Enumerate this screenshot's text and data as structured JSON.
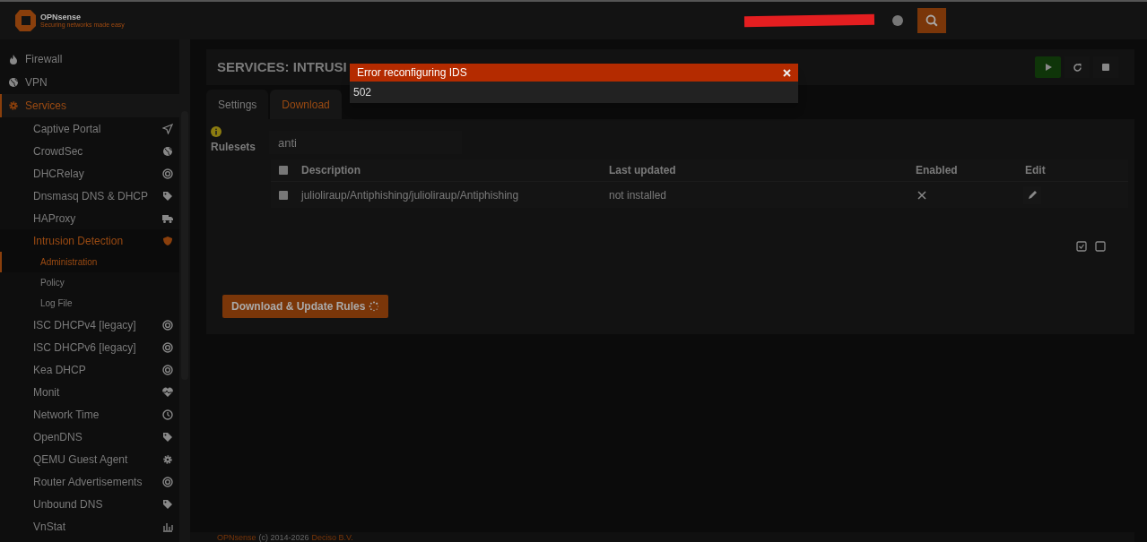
{
  "header": {
    "logo_text": "OPNsense",
    "logo_tagline": "Securing networks made easy"
  },
  "sidebar": {
    "items": [
      {
        "label": "Firewall",
        "selected": false
      },
      {
        "label": "VPN",
        "selected": false
      },
      {
        "label": "Services",
        "selected": true,
        "children": [
          {
            "label": "Captive Portal",
            "selected": false
          },
          {
            "label": "CrowdSec",
            "selected": false
          },
          {
            "label": "DHCRelay",
            "selected": false
          },
          {
            "label": "Dnsmasq DNS & DHCP",
            "selected": false
          },
          {
            "label": "HAProxy",
            "selected": false
          },
          {
            "label": "Intrusion Detection",
            "selected": true,
            "children": [
              {
                "label": "Administration",
                "selected": true
              },
              {
                "label": "Policy",
                "selected": false
              },
              {
                "label": "Log File",
                "selected": false
              }
            ]
          },
          {
            "label": "ISC DHCPv4 [legacy]",
            "selected": false
          },
          {
            "label": "ISC DHCPv6 [legacy]",
            "selected": false
          },
          {
            "label": "Kea DHCP",
            "selected": false
          },
          {
            "label": "Monit",
            "selected": false
          },
          {
            "label": "Network Time",
            "selected": false
          },
          {
            "label": "OpenDNS",
            "selected": false
          },
          {
            "label": "QEMU Guest Agent",
            "selected": false
          },
          {
            "label": "Router Advertisements",
            "selected": false
          },
          {
            "label": "Unbound DNS",
            "selected": false
          },
          {
            "label": "VnStat",
            "selected": false
          }
        ]
      }
    ]
  },
  "page": {
    "title": "SERVICES: INTRUSI",
    "tabs": [
      {
        "label": "Settings",
        "selected": false
      },
      {
        "label": "Download",
        "selected": true
      }
    ]
  },
  "rulesets": {
    "label": "Rulesets",
    "search": {
      "value": "anti"
    },
    "select_all_checked": false,
    "columns": [
      "Description",
      "Last updated",
      "Enabled",
      "Edit"
    ],
    "rows": [
      {
        "checked": false,
        "description": "julioliraup/Antiphishing/julioliraup/Antiphishing",
        "last_updated": "not installed",
        "enabled": false
      }
    ]
  },
  "download_button": {
    "label": "Download & Update Rules",
    "busy": true
  },
  "footer": {
    "brand": "OPNsense",
    "copyright": "(c) 2014-2026",
    "company": "Deciso B.V."
  },
  "modal": {
    "title": "Error reconfiguring IDS",
    "message": "502"
  }
}
